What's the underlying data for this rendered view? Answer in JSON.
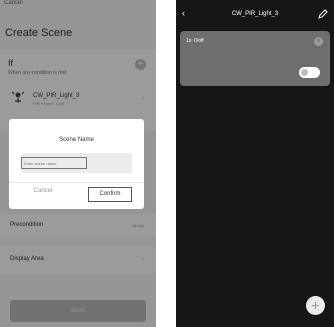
{
  "left": {
    "cancel_label": "Cancel",
    "title": "Create Scene",
    "if_section": {
      "label": "If",
      "subtitle": "When any condition is met"
    },
    "device": {
      "name": "CW_PIR_Light_3",
      "subtitle": "PIR Sensor: 1/Off"
    },
    "dialog": {
      "title": "Scene Name",
      "placeholder": "Enter scene name",
      "cancel_label": "Cancel",
      "confirm_label": "Confirm"
    },
    "precondition": {
      "label": "Precondition",
      "value": "All day"
    },
    "display_area_label": "Display Area",
    "save_label": "Save"
  },
  "right": {
    "title": "CW_PIR_Light_3",
    "card_label": "1s: 0/off",
    "toggle_on": true
  },
  "colors": {
    "right_background": "#161616",
    "card_background": "#6e6e6e",
    "dialog_overlay": "rgba(0,0,0,0.38)"
  }
}
